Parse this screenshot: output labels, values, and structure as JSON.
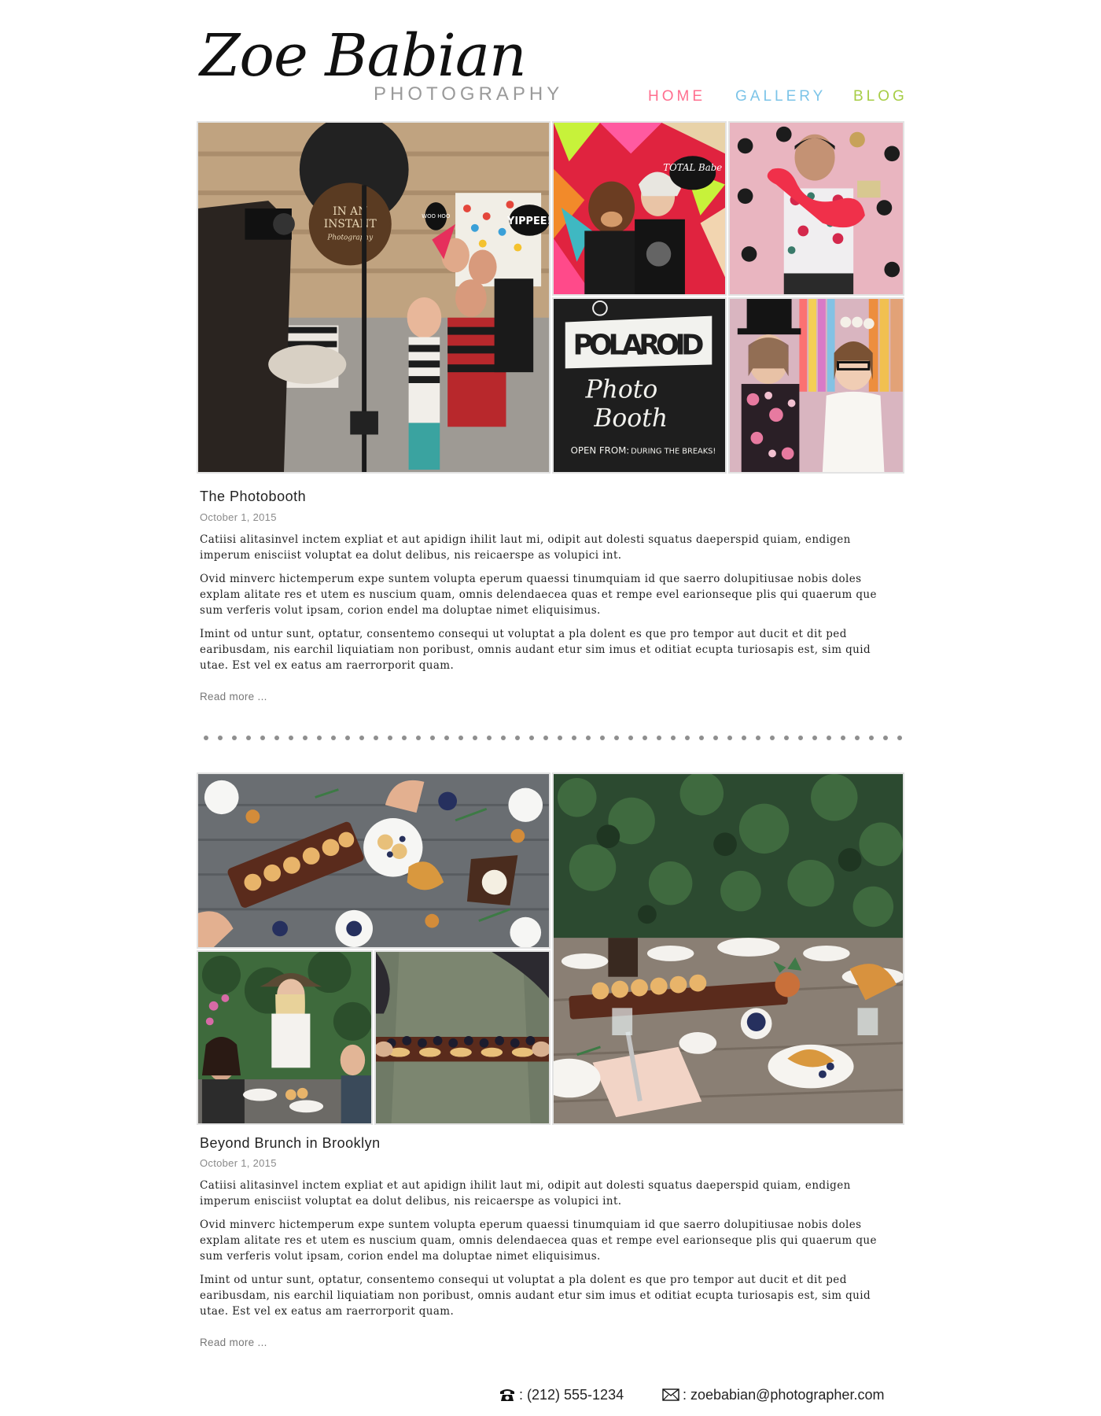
{
  "header": {
    "logo_name": "Zoe Babian",
    "logo_sub": "PHOTOGRAPHY",
    "nav": [
      {
        "label": "HOME",
        "color": "#ff6f8f"
      },
      {
        "label": "GALLERY",
        "color": "#7cc4e8"
      },
      {
        "label": "BLOG",
        "color": "#a7cd46"
      }
    ]
  },
  "posts": [
    {
      "title": "The Photobooth",
      "date": "October 1, 2015",
      "paragraphs": [
        "Catiisi alitasinvel inctem expliat et aut apidign ihilit laut mi, odipit aut dolesti squatus daeperspid quiam, endigen imperum enisciist voluptat ea dolut delibus, nis reicaerspe as volupici int.",
        "Ovid minverc hictemperum expe suntem volupta eperum quaessi tinumquiam id que saerro dolupitiusae nobis doles explam alitate res et utem es nuscium quam, omnis delendaecea quas et rempe evel earionseque plis qui quaerum que sum verferis volut ipsam, corion endel ma doluptae nimet eliquisimus.",
        "Imint od untur sunt, optatur, consentemo consequi ut voluptat a pla dolent es que pro tempor aut ducit et dit ped earibusdam, nis earchil liquiatiam non poribust, omnis audant etur sim imus et oditiat ecupta turiosapis est, sim quid utae. Est vel ex eatus am raerrorporit quam."
      ],
      "read_more": "Read more ...",
      "photo_text": {
        "sign_line1": "IN AN",
        "sign_line2": "INSTANT",
        "sign_line3": "Photography",
        "yippee": "YIPPEE!",
        "woo": "WOO HOO",
        "total_babe": "TOTAL Babe",
        "polaroid": "POLAROID",
        "photo": "Photo",
        "booth": "Booth",
        "open_from": "OPEN FROM:",
        "during_breaks": "DURING THE BREAKS!"
      }
    },
    {
      "title": "Beyond Brunch in Brooklyn",
      "date": "October 1, 2015",
      "paragraphs": [
        "Catiisi alitasinvel inctem expliat et aut apidign ihilit laut mi, odipit aut dolesti squatus daeperspid quiam, endigen imperum enisciist voluptat ea dolut delibus, nis reicaerspe as volupici int.",
        "Ovid minverc hictemperum expe suntem volupta eperum quaessi tinumquiam id que saerro dolupitiusae nobis doles explam alitate res et utem es nuscium quam, omnis delendaecea quas et rempe evel earionseque plis qui quaerum que sum verferis volut ipsam, corion endel ma doluptae nimet eliquisimus.",
        "Imint od untur sunt, optatur, consentemo consequi ut voluptat a pla dolent es que pro tempor aut ducit et dit ped earibusdam, nis earchil liquiatiam non poribust, omnis audant etur sim imus et oditiat ecupta turiosapis est, sim quid utae. Est vel ex eatus am raerrorporit quam."
      ],
      "read_more": "Read more ..."
    }
  ],
  "footer": {
    "phone_icon": "phone-icon",
    "phone": ": (212) 555-1234",
    "email_icon": "envelope-icon",
    "email": ": zoebabian@photographer.com"
  }
}
